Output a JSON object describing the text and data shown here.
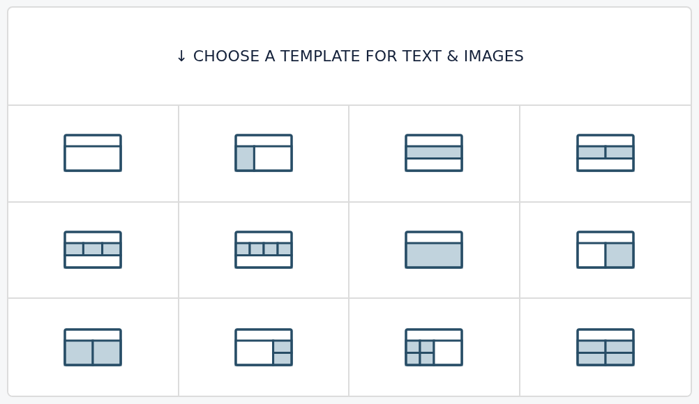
{
  "heading": "↓ CHOOSE A TEMPLATE FOR TEXT & IMAGES",
  "templates": [
    {
      "kind": "header-body"
    },
    {
      "kind": "sidebar-left"
    },
    {
      "kind": "band"
    },
    {
      "kind": "band-two"
    },
    {
      "kind": "band-three"
    },
    {
      "kind": "band-four"
    },
    {
      "kind": "body-filled"
    },
    {
      "kind": "sidebar-right"
    },
    {
      "kind": "two-columns"
    },
    {
      "kind": "right-stack"
    },
    {
      "kind": "left-grid"
    },
    {
      "kind": "grid-four"
    }
  ]
}
